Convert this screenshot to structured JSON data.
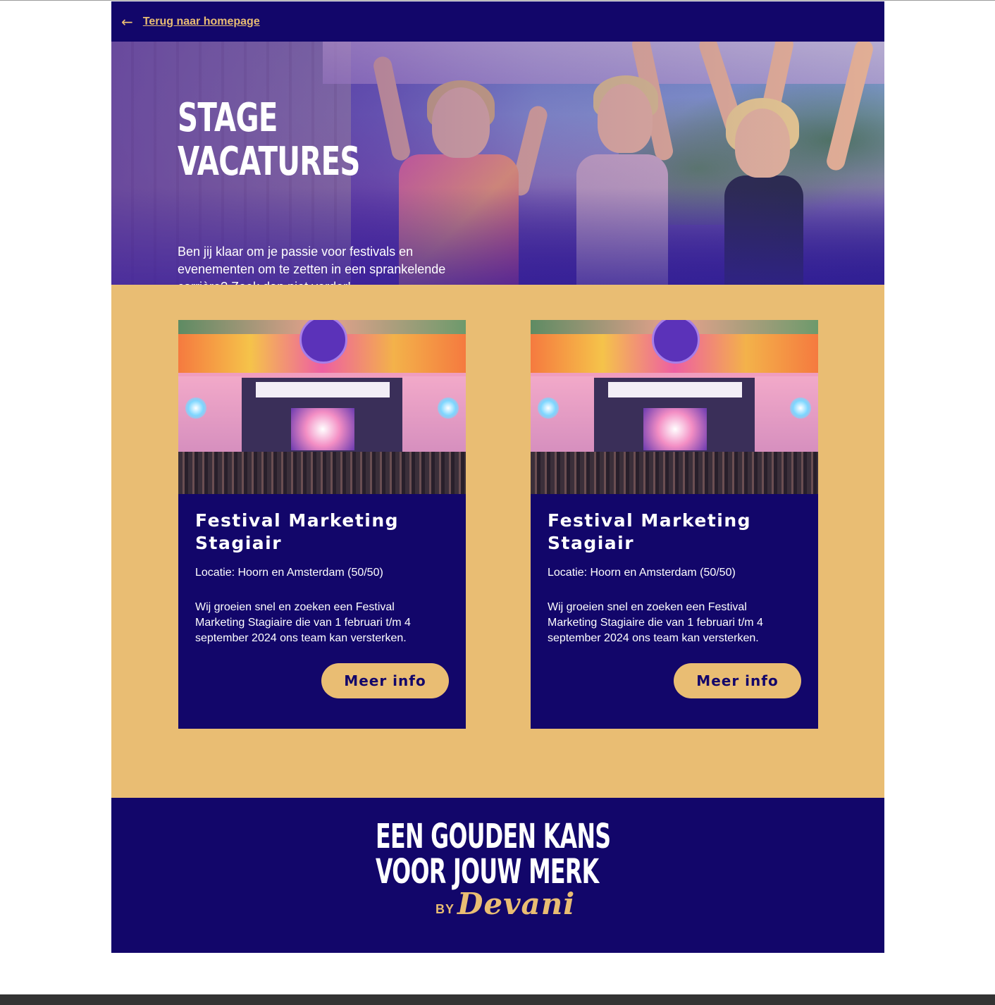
{
  "nav": {
    "back_label": "Terug naar homepage",
    "back_icon": "arrow-left-icon"
  },
  "hero": {
    "title": "STAGE\nVACATURES",
    "text": "Ben jij klaar om je passie voor festivals en evenementen om te zetten in een sprankelende carrière? Zoek dan niet verder!"
  },
  "cards": [
    {
      "title": "Festival Marketing Stagiair",
      "location": "Locatie: Hoorn en Amsterdam (50/50)",
      "description": "Wij groeien snel en zoeken een Festival Marketing Stagiaire die van 1 februari t/m 4 september 2024 ons team kan versterken.",
      "button_label": "Meer info"
    },
    {
      "title": "Festival Marketing Stagiair",
      "location": "Locatie: Hoorn en Amsterdam (50/50)",
      "description": "Wij groeien snel en zoeken een Festival Marketing Stagiaire die van 1 februari t/m 4 september 2024 ons team kan versterken.",
      "button_label": "Meer info"
    }
  ],
  "footer": {
    "line1": "EEN GOUDEN KANS",
    "line2": "VOOR JOUW MERK",
    "by": "BY",
    "brand": "Devani"
  },
  "colors": {
    "navy": "#12066a",
    "gold": "#e9bd73",
    "white": "#ffffff"
  }
}
